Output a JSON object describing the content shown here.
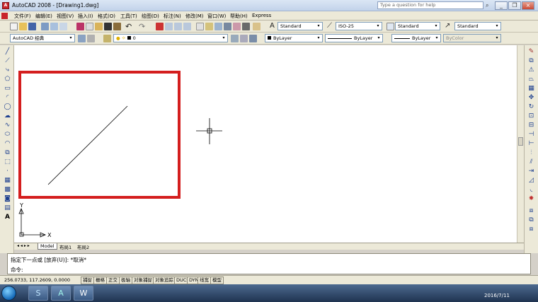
{
  "window": {
    "title": "AutoCAD 2008 - [Drawing1.dwg]",
    "app_icon_text": "A",
    "help_placeholder": "Type a question for help",
    "minimize_symbol": "_",
    "restore_symbol": "❐",
    "close_symbol": "×"
  },
  "menu": {
    "items": [
      "文件(F)",
      "编辑(E)",
      "视图(V)",
      "插入(I)",
      "格式(O)",
      "工具(T)",
      "绘图(D)",
      "标注(N)",
      "修改(M)",
      "窗口(W)",
      "帮助(H)",
      "Express"
    ]
  },
  "toolbar_styles": {
    "text_style": "Standard",
    "dim_style": "ISO-25",
    "table_style": "Standard",
    "multileader_style": "Standard"
  },
  "toolbar_props": {
    "workspace": "AutoCAD 经典",
    "layer": "0",
    "color": "ByLayer",
    "linetype": "ByLayer",
    "lineweight": "ByLayer",
    "plot_style": "ByColor"
  },
  "canvas": {
    "ucs_y": "Y",
    "ucs_x": "X",
    "highlight_color": "#d41e1e"
  },
  "layout_tabs": {
    "nav_arrows": "◂ ◂ ▸ ▸",
    "tabs": [
      "Model",
      "布局1",
      "布局2"
    ]
  },
  "command": {
    "history": "指定下一点或 [放弃(U)]: *取消*",
    "prompt": "命令:"
  },
  "status": {
    "coords": "256.0733, 117.2609, 0.0000",
    "toggles": [
      "捕捉",
      "栅格",
      "正交",
      "极轴",
      "对象捕捉",
      "对象追踪",
      "DUCS",
      "DYN",
      "线宽",
      "模型"
    ]
  },
  "taskbar": {
    "apps": [
      {
        "label": "S",
        "color": "#2aa6e0"
      },
      {
        "label": "A",
        "color": "#1aa39b"
      },
      {
        "label": "W",
        "color": "#2b5797"
      }
    ],
    "date": "2016/7/11"
  }
}
